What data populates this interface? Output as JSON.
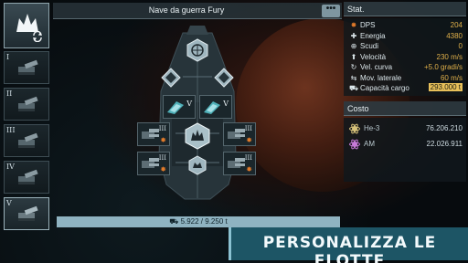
{
  "title": "Nave da guerra Fury",
  "more_label": "•••",
  "slots": [
    {
      "num": "I"
    },
    {
      "num": "II"
    },
    {
      "num": "III"
    },
    {
      "num": "IV"
    },
    {
      "num": "V"
    }
  ],
  "ship_modules": {
    "weapon_v_label": "V",
    "weapon_iii_label": "III"
  },
  "cargo_text": "5.922 / 9.250 t",
  "stats": {
    "header": "Stat.",
    "rows": [
      {
        "icon": "dps-icon",
        "label": "DPS",
        "value": "204"
      },
      {
        "icon": "energy-icon",
        "label": "Energia",
        "value": "4380"
      },
      {
        "icon": "shield-icon",
        "label": "Scudi",
        "value": "0"
      },
      {
        "icon": "speed-icon",
        "label": "Velocità",
        "value": "230 m/s"
      },
      {
        "icon": "turn-icon",
        "label": "Vel. curva",
        "value": "+5.0 gradi/s"
      },
      {
        "icon": "strafe-icon",
        "label": "Mov. laterale",
        "value": "60 m/s"
      },
      {
        "icon": "cargo-icon",
        "label": "Capacità cargo",
        "value": "293.000 t"
      }
    ]
  },
  "cost": {
    "header": "Costo",
    "rows": [
      {
        "icon": "he3-icon",
        "label": "He-3",
        "value": "76.206.210"
      },
      {
        "icon": "am-icon",
        "label": "AM",
        "value": "22.026.911"
      }
    ]
  },
  "banner": "PERSONALIZZA LE FLOTTE",
  "colors": {
    "accent": "#8fb3c1",
    "banner": "#1d5565",
    "chip": "#e8c05a",
    "dps": "#e07a2a"
  }
}
